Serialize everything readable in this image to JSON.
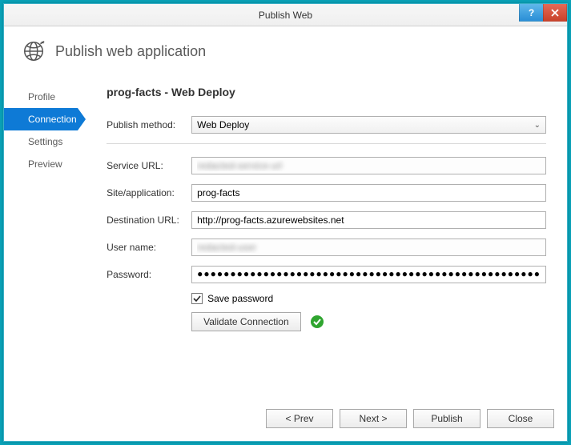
{
  "window": {
    "title": "Publish Web"
  },
  "header": {
    "title": "Publish web application"
  },
  "sidebar": {
    "items": [
      {
        "label": "Profile"
      },
      {
        "label": "Connection"
      },
      {
        "label": "Settings"
      },
      {
        "label": "Preview"
      }
    ],
    "active_index": 1
  },
  "page": {
    "title": "prog-facts - Web Deploy",
    "publish_method_label": "Publish method:",
    "publish_method_value": "Web Deploy",
    "service_url_label": "Service URL:",
    "service_url_value": "redacted-service-url",
    "site_app_label": "Site/application:",
    "site_app_value": "prog-facts",
    "dest_url_label": "Destination URL:",
    "dest_url_value": "http://prog-facts.azurewebsites.net",
    "username_label": "User name:",
    "username_value": "redacted-user",
    "password_label": "Password:",
    "password_value": "●●●●●●●●●●●●●●●●●●●●●●●●●●●●●●●●●●●●●●●●●●●●●●●●●●●●",
    "save_password_label": "Save password",
    "save_password_checked": true,
    "validate_button": "Validate Connection",
    "validated": true
  },
  "footer": {
    "prev": "< Prev",
    "next": "Next >",
    "publish": "Publish",
    "close": "Close"
  }
}
